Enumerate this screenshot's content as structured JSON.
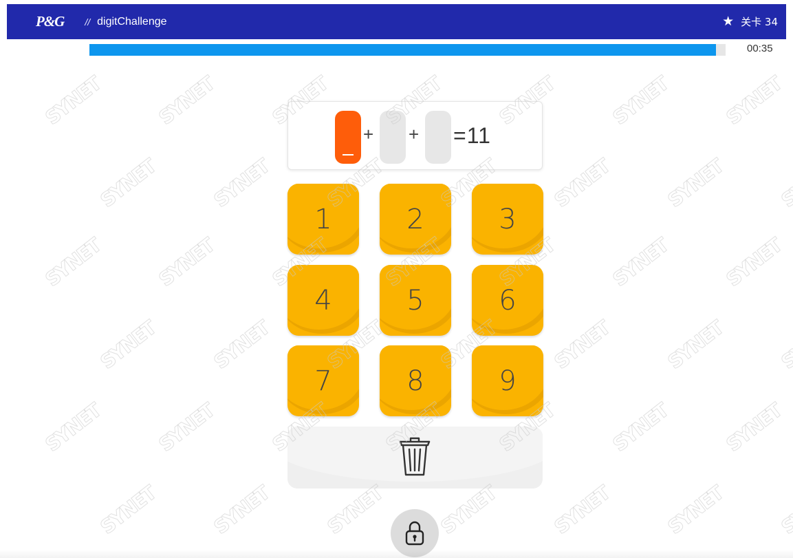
{
  "header": {
    "logo": "P&G",
    "separator": "//",
    "app_title": "digitChallenge",
    "star_icon": "star-icon",
    "level_label": "关卡 34"
  },
  "progress": {
    "fraction": 0.985,
    "timer": "00:35",
    "color": "#0d96ee"
  },
  "equation": {
    "slots": [
      {
        "value": "",
        "active": true
      },
      {
        "value": "",
        "active": false
      },
      {
        "value": "",
        "active": false
      }
    ],
    "operators": [
      "+",
      "+"
    ],
    "result": "=11"
  },
  "keypad": {
    "keys": [
      "1",
      "2",
      "3",
      "4",
      "5",
      "6",
      "7",
      "8",
      "9"
    ],
    "color": "#fbb301"
  },
  "actions": {
    "delete_icon": "trash-icon",
    "lock_icon": "lock-icon"
  },
  "watermark": {
    "text": "SYNET"
  },
  "colors": {
    "header_bg": "#2129ab",
    "active_slot": "#fe5d0a",
    "inactive_slot": "#e7e7e7"
  }
}
